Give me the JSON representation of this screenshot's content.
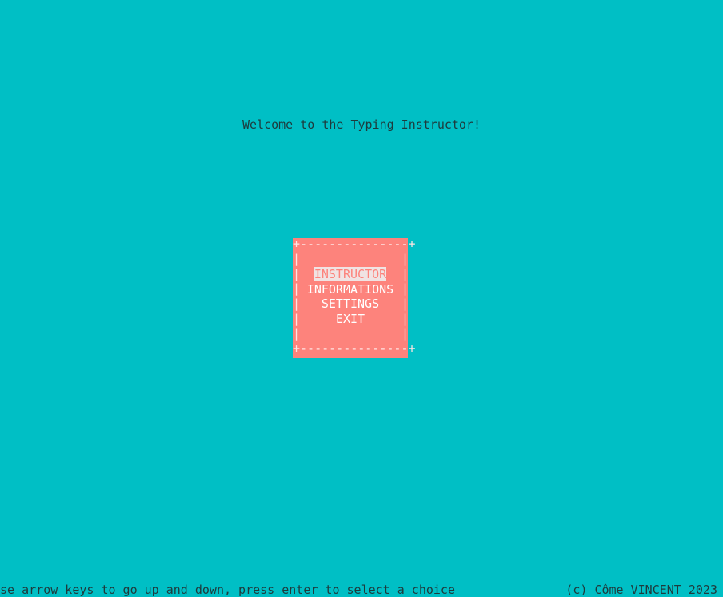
{
  "welcome_text": "Welcome to the Typing Instructor!",
  "menu": {
    "border_top": "+---------------+",
    "border_bottom": "+---------------+",
    "side_char": "|",
    "items": [
      {
        "label": "INSTRUCTOR",
        "selected": true
      },
      {
        "label": "INFORMATIONS",
        "selected": false
      },
      {
        "label": "SETTINGS",
        "selected": false
      },
      {
        "label": "EXIT",
        "selected": false
      }
    ]
  },
  "footer": {
    "help_text": "Use arrow keys to go up and down, press enter to select a choice",
    "copyright": "(c) Côme VINCENT 2023"
  },
  "colors": {
    "background": "#00bfc5",
    "menu_background": "#fd837c",
    "selected_highlight": "#f0e3e3",
    "text": "#1e3a3c"
  }
}
